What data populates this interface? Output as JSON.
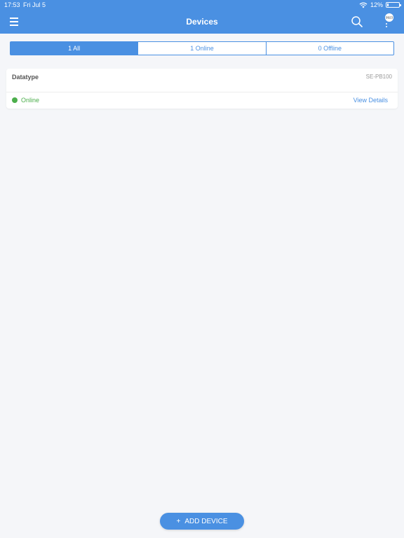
{
  "status_bar": {
    "time": "17:53",
    "date": "Fri Jul 5",
    "battery": "12%"
  },
  "header": {
    "title": "Devices",
    "menu_icon": "hamburger-menu-icon",
    "search_icon": "search-icon",
    "more_icon": "more-vertical-icon",
    "badge": "9923"
  },
  "filters": {
    "tabs": [
      {
        "label": "1 All",
        "active": true
      },
      {
        "label": "1 Online",
        "active": false
      },
      {
        "label": "0 Offline",
        "active": false
      }
    ]
  },
  "devices": [
    {
      "name": "Datatype",
      "model": "SE-PB100",
      "status": "Online",
      "action": "View Details"
    }
  ],
  "add_button": {
    "icon": "+",
    "label": "ADD DEVICE"
  },
  "colors": {
    "primary": "#4a90e2",
    "online": "#4cae4c",
    "background": "#f5f6f9"
  }
}
